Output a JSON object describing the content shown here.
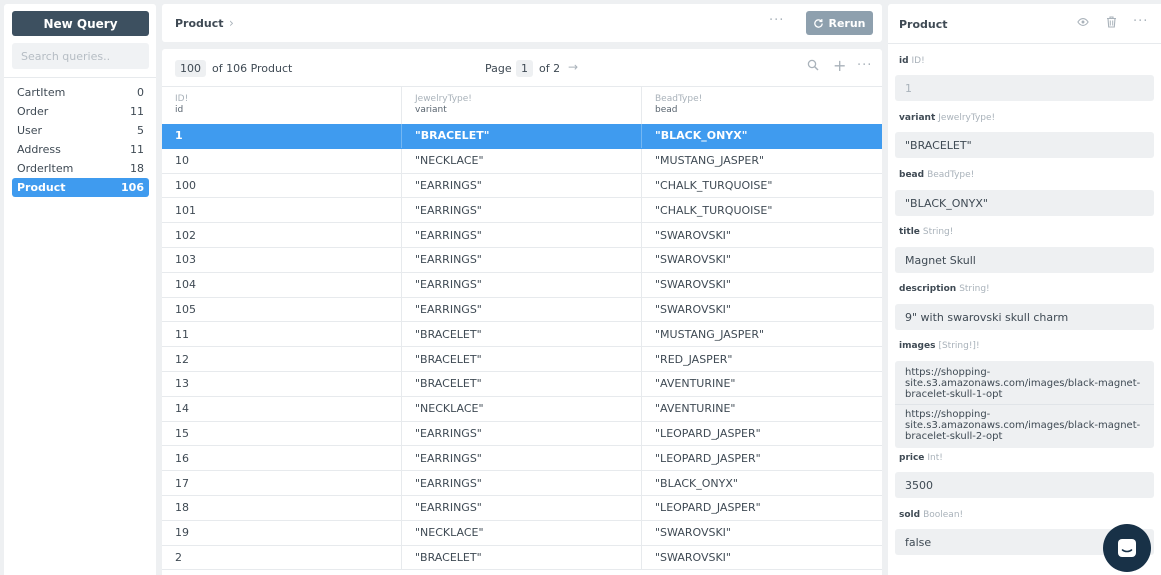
{
  "sidebar": {
    "new_query_label": "New Query",
    "search_placeholder": "Search queries..",
    "types": [
      {
        "name": "CartItem",
        "count": "0"
      },
      {
        "name": "Order",
        "count": "11"
      },
      {
        "name": "User",
        "count": "5"
      },
      {
        "name": "Address",
        "count": "11"
      },
      {
        "name": "OrderItem",
        "count": "18"
      },
      {
        "name": "Product",
        "count": "106"
      }
    ],
    "active_type": "Product"
  },
  "header": {
    "title": "Product",
    "more_label": "···",
    "rerun_label": "Rerun"
  },
  "table": {
    "limit": "100",
    "count_label": "of 106 Product",
    "page_label": "Page",
    "page_number": "1",
    "page_total_label": "of 2",
    "columns": [
      {
        "type": "ID!",
        "name": "id"
      },
      {
        "type": "JewelryType!",
        "name": "variant"
      },
      {
        "type": "BeadType!",
        "name": "bead"
      }
    ],
    "rows": [
      [
        "1",
        "\"BRACELET\"",
        "\"BLACK_ONYX\""
      ],
      [
        "10",
        "\"NECKLACE\"",
        "\"MUSTANG_JASPER\""
      ],
      [
        "100",
        "\"EARRINGS\"",
        "\"CHALK_TURQUOISE\""
      ],
      [
        "101",
        "\"EARRINGS\"",
        "\"CHALK_TURQUOISE\""
      ],
      [
        "102",
        "\"EARRINGS\"",
        "\"SWAROVSKI\""
      ],
      [
        "103",
        "\"EARRINGS\"",
        "\"SWAROVSKI\""
      ],
      [
        "104",
        "\"EARRINGS\"",
        "\"SWAROVSKI\""
      ],
      [
        "105",
        "\"EARRINGS\"",
        "\"SWAROVSKI\""
      ],
      [
        "11",
        "\"BRACELET\"",
        "\"MUSTANG_JASPER\""
      ],
      [
        "12",
        "\"BRACELET\"",
        "\"RED_JASPER\""
      ],
      [
        "13",
        "\"BRACELET\"",
        "\"AVENTURINE\""
      ],
      [
        "14",
        "\"NECKLACE\"",
        "\"AVENTURINE\""
      ],
      [
        "15",
        "\"EARRINGS\"",
        "\"LEOPARD_JASPER\""
      ],
      [
        "16",
        "\"EARRINGS\"",
        "\"LEOPARD_JASPER\""
      ],
      [
        "17",
        "\"EARRINGS\"",
        "\"BLACK_ONYX\""
      ],
      [
        "18",
        "\"EARRINGS\"",
        "\"LEOPARD_JASPER\""
      ],
      [
        "19",
        "\"NECKLACE\"",
        "\"SWAROVSKI\""
      ],
      [
        "2",
        "\"BRACELET\"",
        "\"SWAROVSKI\""
      ]
    ],
    "selected_row_index": 0
  },
  "detail": {
    "title": "Product",
    "fields": {
      "id": {
        "label": "id",
        "type": "ID!",
        "value": "1"
      },
      "variant": {
        "label": "variant",
        "type": "JewelryType!",
        "value": "\"BRACELET\""
      },
      "bead": {
        "label": "bead",
        "type": "BeadType!",
        "value": "\"BLACK_ONYX\""
      },
      "title": {
        "label": "title",
        "type": "String!",
        "value": "Magnet Skull"
      },
      "description": {
        "label": "description",
        "type": "String!",
        "value": "9\" with swarovski skull charm"
      },
      "images": {
        "label": "images",
        "type": "[String!]!",
        "values": [
          "https://shopping-site.s3.amazonaws.com/images/black-magnet-bracelet-skull-1-opt",
          "https://shopping-site.s3.amazonaws.com/images/black-magnet-bracelet-skull-2-opt"
        ]
      },
      "price": {
        "label": "price",
        "type": "Int!",
        "value": "3500"
      },
      "sold": {
        "label": "sold",
        "type": "Boolean!",
        "value": "false"
      }
    }
  },
  "colors": {
    "accent": "#3f9bef",
    "dark_button": "#3d5060",
    "rerun_button": "#8ea0ae",
    "chat_button": "#183147"
  }
}
